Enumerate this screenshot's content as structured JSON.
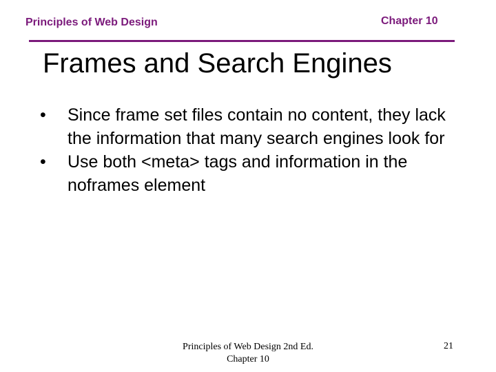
{
  "header": {
    "course": "Principles of Web Design",
    "chapter": "Chapter 10",
    "accent_color": "#7b1a7b"
  },
  "slide": {
    "title": "Frames and Search Engines",
    "bullets": [
      "Since frame set files contain no content, they lack the information that many search engines look for",
      "Use both <meta> tags and information in the noframes element"
    ],
    "bullet_symbol": "•"
  },
  "footer": {
    "line1": "Principles of Web Design 2nd Ed.",
    "line2": "Chapter 10",
    "page_number": "21"
  }
}
